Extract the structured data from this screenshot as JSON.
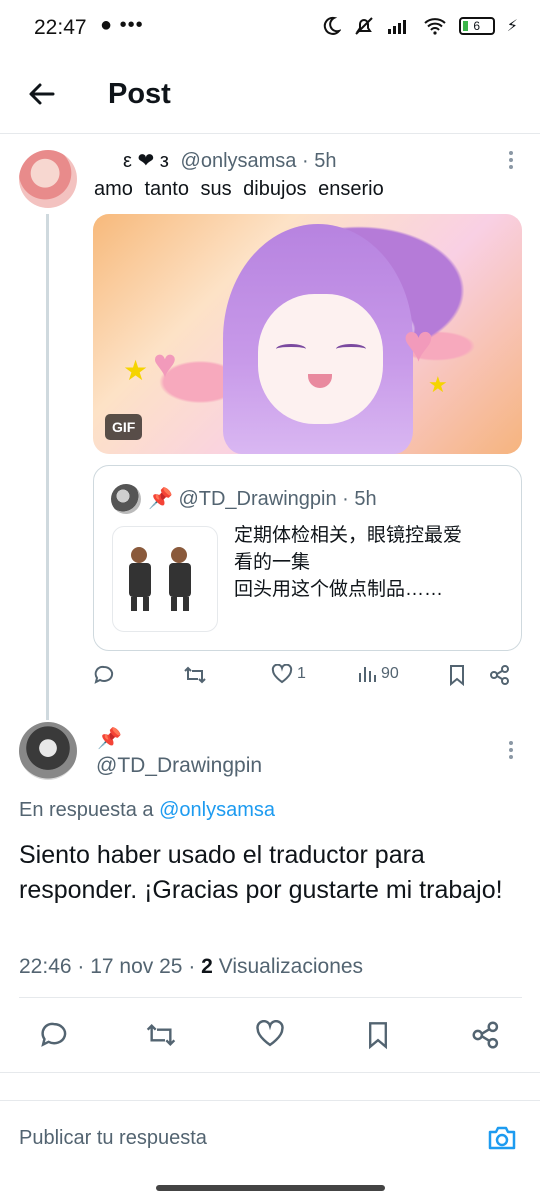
{
  "status_bar": {
    "time": "22:47",
    "extra": "•••",
    "battery": "6"
  },
  "header": {
    "title": "Post"
  },
  "tweet1": {
    "display_name": "ε ❤ з",
    "handle": "@onlysamsa",
    "time": "5h",
    "text": "amo tanto sus dibujos enserio",
    "gif_badge": "GIF",
    "quote": {
      "pin": "📌",
      "handle": "@TD_Drawingpin",
      "time": "5h",
      "text_lines": [
        "定期体检相关，眼镜控最爱",
        "看的一集",
        "回头用这个做点制品……"
      ]
    },
    "actions": {
      "likes": "1",
      "views": "90"
    }
  },
  "tweet2": {
    "pin": "📌",
    "handle": "@TD_Drawingpin",
    "reply_prefix": "En respuesta a",
    "reply_handle": "@onlysamsa",
    "text": "Siento haber usado el traductor para responder. ¡Gracias por gustarte mi trabajo!",
    "time": "22:46",
    "date": "17 nov 25",
    "views_count": "2",
    "views_label": "Visualizaciones"
  },
  "composer": {
    "placeholder": "Publicar tu respuesta"
  },
  "colors": {
    "accent": "#1d9bf0",
    "muted": "#536471",
    "text": "#0f1419"
  }
}
